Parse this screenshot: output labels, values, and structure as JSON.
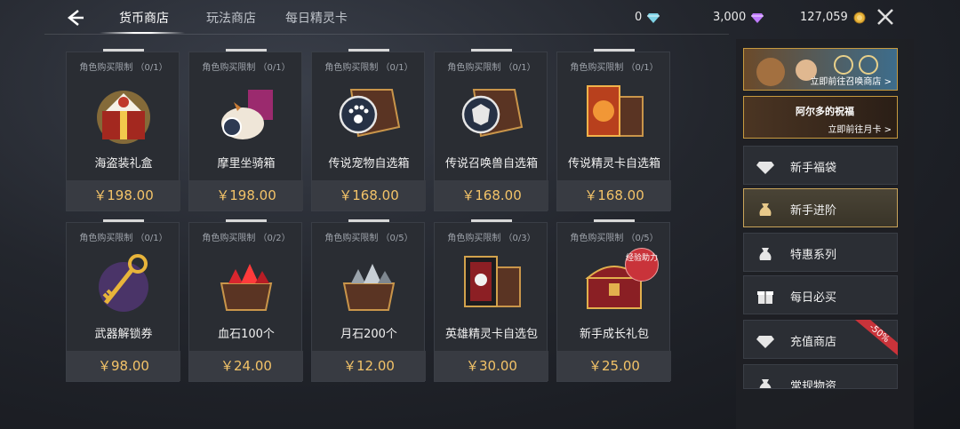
{
  "topbar": {
    "tabs": [
      {
        "label": "货币商店",
        "active": true
      },
      {
        "label": "玩法商店",
        "active": false
      },
      {
        "label": "每日精灵卡",
        "active": false
      }
    ],
    "currencies": [
      {
        "value": "0",
        "icon": "diamond-icon",
        "color": "#7fd3e6"
      },
      {
        "value": "3,000",
        "icon": "purple-gem-icon",
        "color": "#c07bff"
      },
      {
        "value": "127,059",
        "icon": "gold-coin-icon",
        "color": "#e8b43a"
      }
    ]
  },
  "items": [
    {
      "limit": "角色购买限制 （0/1）",
      "name": "海盗装礼盒",
      "price": "￥198.00",
      "art": "pirate-outfit-gift-box"
    },
    {
      "limit": "角色购买限制 （0/1）",
      "name": "摩里坐骑箱",
      "price": "￥198.00",
      "art": "mount-box"
    },
    {
      "limit": "角色购买限制 （0/1）",
      "name": "传说宠物自选箱",
      "price": "￥168.00",
      "art": "pet-select-box"
    },
    {
      "limit": "角色购买限制 （0/1）",
      "name": "传说召唤兽自选箱",
      "price": "￥168.00",
      "art": "summon-select-box"
    },
    {
      "limit": "角色购买限制 （0/1）",
      "name": "传说精灵卡自选箱",
      "price": "￥168.00",
      "art": "spirit-card-select-box"
    },
    {
      "limit": "角色购买限制 （0/1）",
      "name": "武器解锁券",
      "price": "￥98.00",
      "art": "golden-key"
    },
    {
      "limit": "角色购买限制 （0/2）",
      "name": "血石100个",
      "price": "￥24.00",
      "art": "blood-stone-box"
    },
    {
      "limit": "角色购买限制 （0/5）",
      "name": "月石200个",
      "price": "￥12.00",
      "art": "moon-stone-box"
    },
    {
      "limit": "角色购买限制 （0/3）",
      "name": "英雄精灵卡自选包",
      "price": "￥30.00",
      "art": "hero-card-pack"
    },
    {
      "limit": "角色购买限制 （0/5）",
      "name": "新手成长礼包",
      "price": "￥25.00",
      "art": "treasure-chest",
      "badge": "经验助力"
    }
  ],
  "sidebar": {
    "banners": [
      {
        "text": "立即前往召唤商店 >"
      },
      {
        "text": "立即前往月卡 >",
        "title": "阿尔多的祝福"
      }
    ],
    "menu": [
      {
        "label": "新手福袋",
        "icon": "diamond-icon",
        "active": false
      },
      {
        "label": "新手进阶",
        "icon": "pouch-icon",
        "active": true
      },
      {
        "label": "特惠系列",
        "icon": "pouch-icon",
        "active": false
      },
      {
        "label": "每日必买",
        "icon": "gift-icon",
        "active": false
      },
      {
        "label": "充值商店",
        "icon": "diamond-icon",
        "active": false,
        "badge": "-50%"
      },
      {
        "label": "常规物资",
        "icon": "pouch-icon",
        "active": false
      }
    ]
  }
}
